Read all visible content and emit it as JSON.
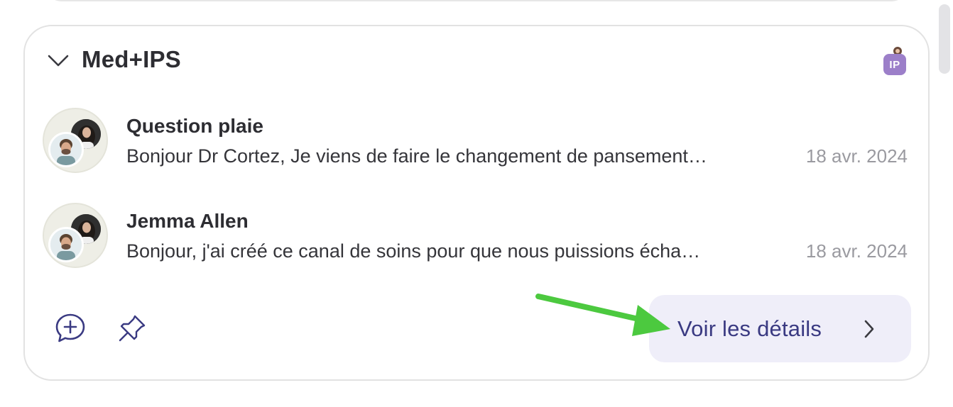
{
  "group": {
    "title": "Med+IPS",
    "member_badge": "IP",
    "collapse_icon": "chevron-down-icon"
  },
  "conversations": [
    {
      "title": "Question plaie",
      "preview": "Bonjour Dr Cortez, Je viens de faire le changement de pansement…",
      "date": "18 avr. 2024"
    },
    {
      "title": "Jemma Allen",
      "preview": "Bonjour, j'ai créé ce canal de soins pour que nous puissions écha…",
      "date": "18 avr. 2024"
    }
  ],
  "footer": {
    "new_message_icon": "chat-plus-icon",
    "pin_icon": "pin-icon",
    "details_label": "Voir les détails",
    "details_icon": "chevron-right-icon"
  },
  "colors": {
    "accent_text": "#3a3a82",
    "button_bg": "#efeef9",
    "badge": "#9c7fc9",
    "annotation_arrow": "#4cc93f"
  }
}
